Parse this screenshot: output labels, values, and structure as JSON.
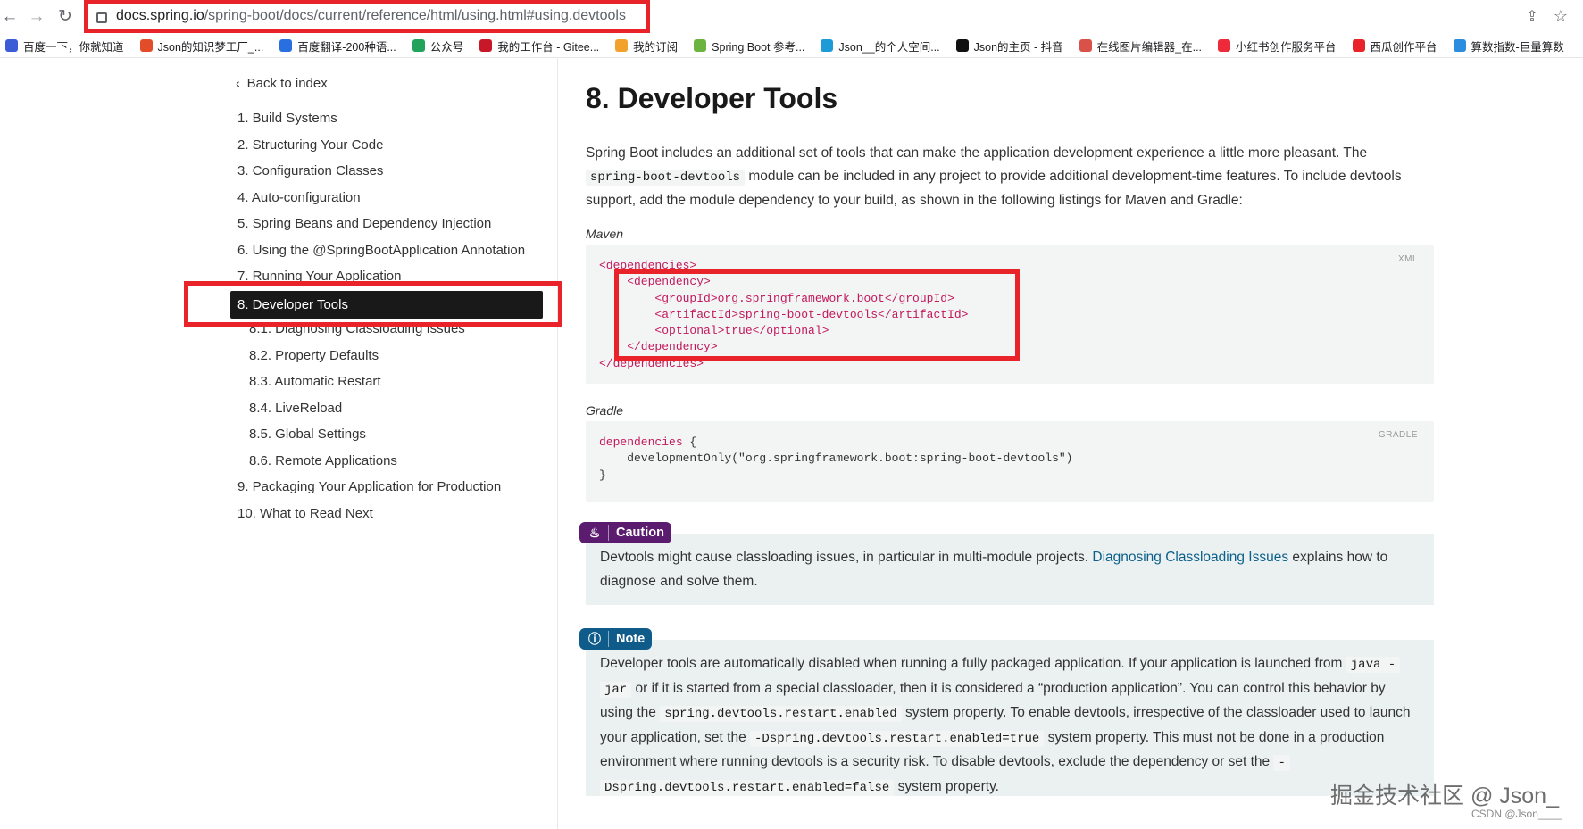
{
  "browser": {
    "url_host": "docs.spring.io",
    "url_path": "/spring-boot/docs/current/reference/html/using.html#using.devtools",
    "back_icon": "back-arrow-icon",
    "forward_icon": "forward-arrow-icon",
    "reload_icon": "reload-icon",
    "bookmarks": [
      {
        "label": "百度一下，你就知道",
        "color": "#3b5cd6"
      },
      {
        "label": "Json的知识梦工厂_...",
        "color": "#e24c29"
      },
      {
        "label": "百度翻译-200种语...",
        "color": "#2a6fe0"
      },
      {
        "label": "公众号",
        "color": "#22a35a"
      },
      {
        "label": "我的工作台 - Gitee...",
        "color": "#c7182a"
      },
      {
        "label": "我的订阅",
        "color": "#f2a12c"
      },
      {
        "label": "Spring Boot 参考...",
        "color": "#6db33f"
      },
      {
        "label": "Json__的个人空间...",
        "color": "#1d9bd7"
      },
      {
        "label": "Json的主页 - 抖音",
        "color": "#111111"
      },
      {
        "label": "在线图片编辑器_在...",
        "color": "#d8524a"
      },
      {
        "label": "小红书创作服务平台",
        "color": "#ee2a3a"
      },
      {
        "label": "西瓜创作平台",
        "color": "#e8232a"
      },
      {
        "label": "算数指数-巨量算数",
        "color": "#2c8de0"
      }
    ]
  },
  "sidebar": {
    "back_label": "Back to index",
    "items": [
      "1. Build Systems",
      "2. Structuring Your Code",
      "3. Configuration Classes",
      "4. Auto-configuration",
      "5. Spring Beans and Dependency Injection",
      "6. Using the @SpringBootApplication Annotation",
      "7. Running Your Application"
    ],
    "active": "8. Developer Tools",
    "subitems": [
      "8.1. Diagnosing Classloading Issues",
      "8.2. Property Defaults",
      "8.3. Automatic Restart",
      "8.4. LiveReload",
      "8.5. Global Settings",
      "8.6. Remote Applications"
    ],
    "after": [
      "9. Packaging Your Application for Production",
      "10. What to Read Next"
    ]
  },
  "content": {
    "title": "8. Developer Tools",
    "intro_1": "Spring Boot includes an additional set of tools that can make the application development experience a little more pleasant. The",
    "intro_code": "spring-boot-devtools",
    "intro_2": "module can be included in any project to provide additional development-time features. To include devtools",
    "intro_3": "support, add the module dependency to your build, as shown in the following listings for Maven and Gradle:",
    "maven_label": "Maven",
    "maven_lang": "XML",
    "maven_lines": [
      "<dependencies>",
      "    <dependency>",
      "        <groupId>org.springframework.boot</groupId>",
      "        <artifactId>spring-boot-devtools</artifactId>",
      "        <optional>true</optional>",
      "    </dependency>",
      "</dependencies>"
    ],
    "gradle_label": "Gradle",
    "gradle_lang": "GRADLE",
    "gradle_line_1": "dependencies",
    "gradle_line_1b": " {",
    "gradle_line_2": "    developmentOnly(\"org.springframework.boot:spring-boot-devtools\")",
    "gradle_line_3": "}",
    "caution_label": "Caution",
    "caution_text_1": "Devtools might cause classloading issues, in particular in multi-module projects.",
    "caution_link": "Diagnosing Classloading Issues",
    "caution_text_2": "explains how to",
    "caution_text_3": "diagnose and solve them.",
    "note_label": "Note",
    "note": {
      "t1": "Developer tools are automatically disabled when running a fully packaged application. If your application is launched from",
      "c1": "java -",
      "c1b": "jar",
      "t2": "or if it is started from a special classloader, then it is considered a “production application”. You can control this behavior by",
      "t3": "using the",
      "c2": "spring.devtools.restart.enabled",
      "t4": "system property. To enable devtools, irrespective of the classloader used to launch",
      "t5": "your application, set the",
      "c3": "-Dspring.devtools.restart.enabled=true",
      "t6": "system property. This must not be done in a production",
      "t7": "environment where running devtools is a security risk. To disable devtools, exclude the dependency or set the",
      "c4": "-",
      "c4b": "Dspring.devtools.restart.enabled=false",
      "t8": "system property."
    }
  },
  "watermark": "掘金技术社区 @ Json_",
  "watermark_small": "CSDN @Json____",
  "colors": {
    "highlight_box": "#e8232a",
    "caution_badge": "#5b1b6e",
    "note_badge": "#0f5b8a"
  }
}
